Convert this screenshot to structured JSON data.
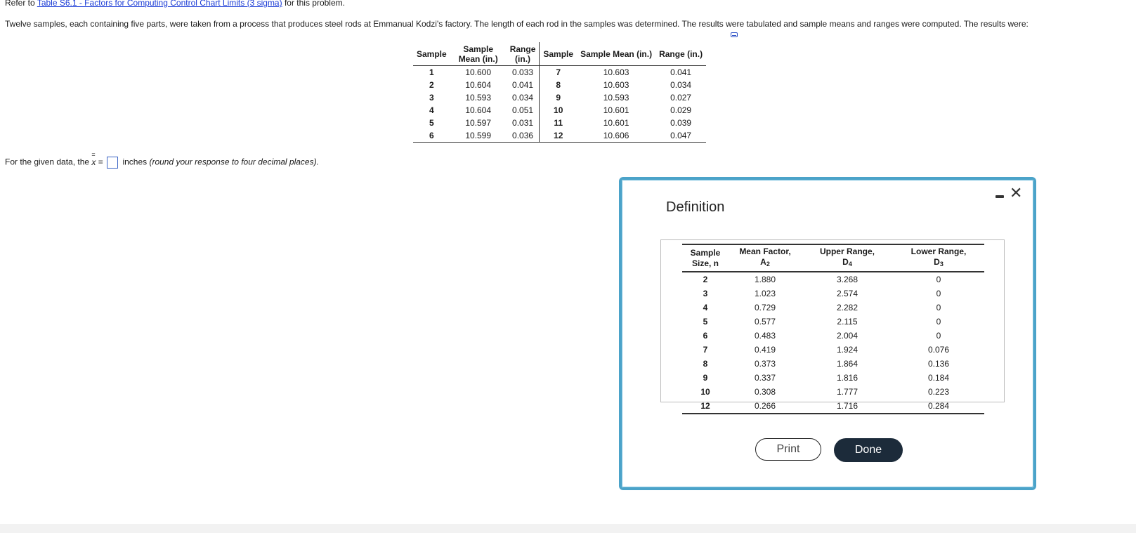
{
  "refer": {
    "prefix": "Refer to ",
    "link": "Table S6.1 - Factors for Computing Control Chart Limits (3 sigma)",
    "suffix": " for this problem."
  },
  "intro": "Twelve samples, each containing five parts, were taken from a process that produces steel rods at Emmanual Kodzi's factory. The length of each rod in the samples was determined. The results were tabulated and sample means and ranges were computed. The results were:",
  "samples_table": {
    "headers_left": [
      "Sample",
      "Sample Mean (in.)",
      "Range (in.)"
    ],
    "headers_right": [
      "Sample",
      "Sample Mean (in.)",
      "Range (in.)"
    ],
    "left": [
      {
        "n": "1",
        "mean": "10.600",
        "range": "0.033"
      },
      {
        "n": "2",
        "mean": "10.604",
        "range": "0.041"
      },
      {
        "n": "3",
        "mean": "10.593",
        "range": "0.034"
      },
      {
        "n": "4",
        "mean": "10.604",
        "range": "0.051"
      },
      {
        "n": "5",
        "mean": "10.597",
        "range": "0.031"
      },
      {
        "n": "6",
        "mean": "10.599",
        "range": "0.036"
      }
    ],
    "right": [
      {
        "n": "7",
        "mean": "10.603",
        "range": "0.041"
      },
      {
        "n": "8",
        "mean": "10.603",
        "range": "0.034"
      },
      {
        "n": "9",
        "mean": "10.593",
        "range": "0.027"
      },
      {
        "n": "10",
        "mean": "10.601",
        "range": "0.029"
      },
      {
        "n": "11",
        "mean": "10.601",
        "range": "0.039"
      },
      {
        "n": "12",
        "mean": "10.606",
        "range": "0.047"
      }
    ]
  },
  "question": {
    "prefix": "For the given data, the ",
    "symbol": "x",
    "equals": " =",
    "answer_value": "",
    "suffix": " inches ",
    "hint": "(round your response to four decimal places)."
  },
  "modal": {
    "title": "Definition",
    "headers": {
      "n_line1": "Sample",
      "n_line2": "Size, n",
      "a2_line1": "Mean Factor,",
      "a2_line2": "A",
      "a2_sub": "2",
      "d4_line1": "Upper Range,",
      "d4_line2": "D",
      "d4_sub": "4",
      "d3_line1": "Lower Range,",
      "d3_line2": "D",
      "d3_sub": "3"
    },
    "rows": [
      {
        "n": "2",
        "a2": "1.880",
        "d4": "3.268",
        "d3": "0"
      },
      {
        "n": "3",
        "a2": "1.023",
        "d4": "2.574",
        "d3": "0"
      },
      {
        "n": "4",
        "a2": "0.729",
        "d4": "2.282",
        "d3": "0"
      },
      {
        "n": "5",
        "a2": "0.577",
        "d4": "2.115",
        "d3": "0"
      },
      {
        "n": "6",
        "a2": "0.483",
        "d4": "2.004",
        "d3": "0"
      },
      {
        "n": "7",
        "a2": "0.419",
        "d4": "1.924",
        "d3": "0.076"
      },
      {
        "n": "8",
        "a2": "0.373",
        "d4": "1.864",
        "d3": "0.136"
      },
      {
        "n": "9",
        "a2": "0.337",
        "d4": "1.816",
        "d3": "0.184"
      },
      {
        "n": "10",
        "a2": "0.308",
        "d4": "1.777",
        "d3": "0.223"
      },
      {
        "n": "12",
        "a2": "0.266",
        "d4": "1.716",
        "d3": "0.284"
      }
    ],
    "print_label": "Print",
    "done_label": "Done",
    "close_glyph": "✕"
  }
}
